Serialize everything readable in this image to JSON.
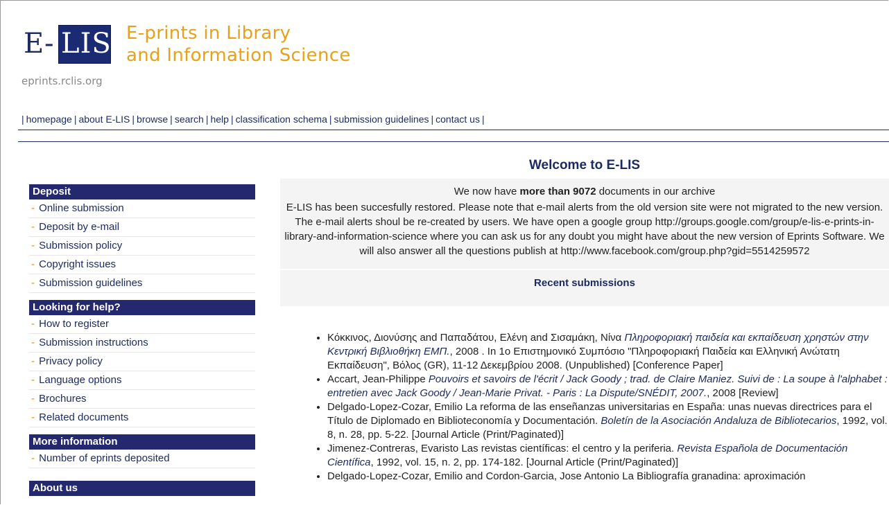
{
  "header": {
    "logo_e": "E-",
    "logo_lis": "LIS",
    "logo_url": "eprints.rclis.org",
    "title_line1": "E-prints in Library",
    "title_line2": "and Information Science"
  },
  "nav": {
    "items": [
      "homepage",
      "about E-LIS",
      "browse",
      "search",
      "help",
      "classification schema",
      "submission guidelines",
      "contact us"
    ]
  },
  "sidebar": {
    "sections": [
      {
        "heading": "Deposit",
        "items": [
          "Online submission",
          "Deposit by e-mail",
          "Submission policy",
          "Copyright issues",
          "Submission guidelines"
        ]
      },
      {
        "heading": "Looking for help?",
        "items": [
          "How to register",
          "Submission instructions",
          "Privacy policy",
          "Language options",
          "Brochures",
          "Related documents"
        ]
      },
      {
        "heading": "More information",
        "items": [
          "Number of eprints deposited"
        ]
      },
      {
        "heading": "About us",
        "items": []
      }
    ]
  },
  "main": {
    "welcome": "Welcome to E-LIS",
    "doc_count_prefix": "We now have ",
    "doc_count_bold": "more than 9072",
    "doc_count_suffix": " documents in our archive",
    "restored_text": "E-LIS has been succesfully restored. Please note that e-mail alerts from the old version site were not migrated to the new version. The e-mail alerts shoul be re-created by users. We have open a google group http://groups.google.com/group/e-lis-e-prints-in-library-and-information-science where you can ask us for any doubt you might have about the new version of Eprints Software. We will also answer all the questions publish at http://www.facebook.com/group.php?gid=5514259572",
    "recent_title": "Recent submissions",
    "submissions": [
      {
        "authors": "Κόκκινος, Διονύσης and Παπαδάτου, Ελένη and Σισαμάκη, Νίνα ",
        "title": "Πληροφοριακή παιδεία και εκπαίδευση χρηστών στην Κεντρική Βιβλιοθήκη ΕΜΠ.",
        "rest": ", 2008 . In 1ο Επιστημονικό Συμπόσιο \"Πληροφοριακή Παιδεία και Ελληνική Ανώτατη Εκπαίδευση\", Βόλος (GR), 11-12 Δεκεμβρίου 2008. (Unpublished) [Conference Paper]"
      },
      {
        "authors": "Accart, Jean-Philippe ",
        "title": "Pouvoirs et savoirs de l'écrit / Jack Goody ; trad. de Claire Maniez. Suivi de : La soupe à l'alphabet : entretien avec Jack Goody / Jean-Marie Privat. - Paris : La Dispute/SNÉDIT, 2007.",
        "rest": ", 2008 [Review]"
      },
      {
        "authors": "Delgado-Lopez-Cozar, Emilio La reforma de las enseñanzas universitarias en España: unas nuevas directrices para el Título de Diplomado en Biblioteconomía y Documentación. ",
        "title": "Boletín de la Asociación Andaluza de Bibliotecarios",
        "rest": ", 1992, vol. 8, n. 28, pp. 5-22. [Journal Article (Print/Paginated)]"
      },
      {
        "authors": "Jimenez-Contreras, Evaristo Las revistas científicas: el centro y la periferia. ",
        "title": "Revista Española de Documentación Científica",
        "rest": ", 1992, vol. 15, n. 2, pp. 174-182. [Journal Article (Print/Paginated)]"
      },
      {
        "authors": "Delgado-Lopez-Cozar, Emilio and Cordon-Garcia, Jose Antonio La Bibliografía granadina: aproximación",
        "title": "",
        "rest": ""
      }
    ]
  }
}
